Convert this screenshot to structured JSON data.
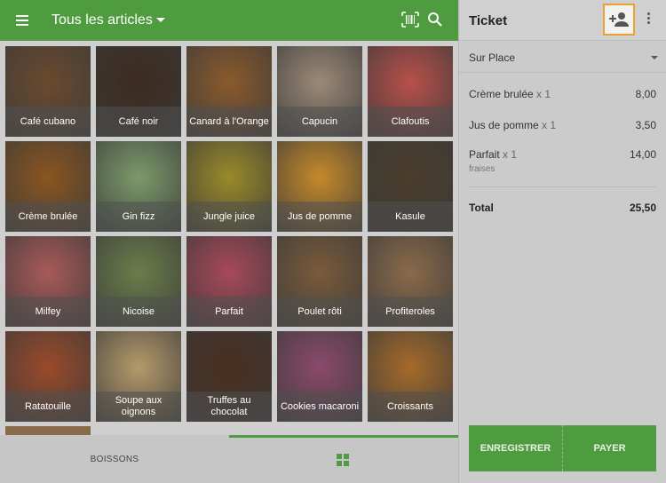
{
  "header": {
    "title": "Tous les articles",
    "menu_icon": "hamburger-menu-icon",
    "barcode_icon": "barcode-scan-icon",
    "search_icon": "search-icon"
  },
  "items": [
    {
      "label": "Café cubano",
      "color": "#6b4a2e"
    },
    {
      "label": "Café noir",
      "color": "#3d2b1f"
    },
    {
      "label": "Canard à l'Orange",
      "color": "#8a5a2c"
    },
    {
      "label": "Capucin",
      "color": "#9c8a76"
    },
    {
      "label": "Clafoutis",
      "color": "#b8504a"
    },
    {
      "label": "Crème brulée",
      "color": "#8a5520"
    },
    {
      "label": "Gin fizz",
      "color": "#7c9a6a"
    },
    {
      "label": "Jungle juice",
      "color": "#9a8a2a"
    },
    {
      "label": "Jus de pomme",
      "color": "#c58a2a"
    },
    {
      "label": "Kasule",
      "color": "#4a3d2a"
    },
    {
      "label": "Milfey",
      "color": "#a85a58"
    },
    {
      "label": "Nicoise",
      "color": "#6b7d4a"
    },
    {
      "label": "Parfait",
      "color": "#a8485a"
    },
    {
      "label": "Poulet rôti",
      "color": "#7a5a3a"
    },
    {
      "label": "Profiteroles",
      "color": "#8a6a4a"
    },
    {
      "label": "Ratatouille",
      "color": "#9a4a2a"
    },
    {
      "label": "Soupe aux oignons",
      "color": "#b59a6a"
    },
    {
      "label": "Truffes au chocolat",
      "color": "#4a2e1e"
    },
    {
      "label": "Cookies macaroni",
      "color": "#8a4a6a"
    },
    {
      "label": "Croissants",
      "color": "#a56a2a"
    }
  ],
  "bottom": {
    "tab_left": "BOISSONS",
    "grid_icon": "grid-icon",
    "accent": "#4f9b3f"
  },
  "ticket": {
    "title": "Ticket",
    "add_customer_icon": "add-customer-icon",
    "more_icon": "more-vert-icon",
    "dining_option": "Sur Place",
    "lines": [
      {
        "name": "Crème brulée",
        "qty": "x 1",
        "price": "8,00",
        "modifier": ""
      },
      {
        "name": "Jus de pomme",
        "qty": "x 1",
        "price": "3,50",
        "modifier": ""
      },
      {
        "name": "Parfait",
        "qty": "x 1",
        "price": "14,00",
        "modifier": "fraises"
      }
    ],
    "total_label": "Total",
    "total_value": "25,50",
    "save_label": "ENREGISTRER",
    "pay_label": "PAYER"
  }
}
